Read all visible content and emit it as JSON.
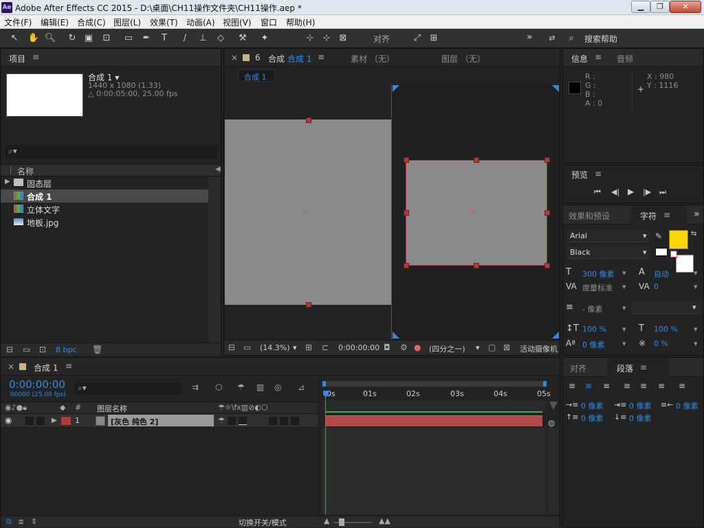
{
  "window": {
    "title": "Adobe After Effects CC 2015 - D:\\桌面\\CH11操作文件夹\\CH11操作.aep *",
    "icon_text": "Ae",
    "min": "▁",
    "max": "❐",
    "close": "✕"
  },
  "menu": [
    "文件(F)",
    "编辑(E)",
    "合成(C)",
    "图层(L)",
    "效果(T)",
    "动画(A)",
    "视图(V)",
    "窗口",
    "帮助(H)"
  ],
  "toolbar": {
    "align_label": "对齐",
    "expand": "»",
    "search_label": "搜索帮助"
  },
  "project": {
    "title": "项目",
    "comp_name": "合成 1 ▾",
    "comp_res": "1440 x 1080 (1.33)",
    "comp_dur": "△ 0:00:05:00, 25.00 fps",
    "search_icon": "⌕▾",
    "col_name": "名称",
    "items": [
      {
        "name": "固态层",
        "type": "folder"
      },
      {
        "name": "合成 1",
        "type": "comp"
      },
      {
        "name": "立体文字",
        "type": "comp"
      },
      {
        "name": "地板.jpg",
        "type": "image"
      }
    ],
    "bpc": "8 bpc"
  },
  "composition": {
    "tab_close": "×",
    "tab_lock": "6",
    "tab_label": "合成",
    "tab_name": "合成 1",
    "footage_tab": "素材 （无）",
    "layer_tab": "图层 （无）",
    "breadcrumb": "合成 1",
    "zoom": "(14.3%)",
    "timecode": "0:00:00:00",
    "resolution": "(四分之一)",
    "camera": "活动摄像机"
  },
  "info": {
    "title": "信息",
    "audio_tab": "音频",
    "r": "R :",
    "g": "G :",
    "b": "B :",
    "a": "A : 0",
    "x": "X : 980",
    "y": "Y : 1116"
  },
  "preview": {
    "title": "预览",
    "buttons": [
      "⏮",
      "◀|",
      "▶",
      "|▶",
      "⏭"
    ]
  },
  "character": {
    "effects_tab": "效果和预设",
    "title": "字符",
    "font": "Arial",
    "style": "Black",
    "size": "300 像素",
    "leading": "自动",
    "kerning": "度量标准",
    "tracking": "0",
    "stroke": "- 像素",
    "vscale": "100 %",
    "hscale": "100 %",
    "baseline": "0 像素",
    "tsume": "0 %",
    "fill_color": "#ffd400"
  },
  "align": {
    "tab": "对齐"
  },
  "paragraph": {
    "title": "段落",
    "indent_left": "0 像素",
    "indent_first": "0 像素",
    "indent_right": "0 像素",
    "space_before": "0 像素",
    "space_after": "0 像素"
  },
  "timeline": {
    "tab_close": "×",
    "tab_name": "合成 1",
    "timecode": "0:00:00:00",
    "fps": "00000 (25.00 fps)",
    "col_num": "#",
    "col_name": "图层名称",
    "ruler": [
      "0s",
      "01s",
      "02s",
      "03s",
      "04s",
      "05s"
    ],
    "layers": [
      {
        "num": "1",
        "name": "[灰色 纯色 2]",
        "label_color": "#b03a3a"
      }
    ],
    "toggle_label": "切换开关/模式"
  }
}
